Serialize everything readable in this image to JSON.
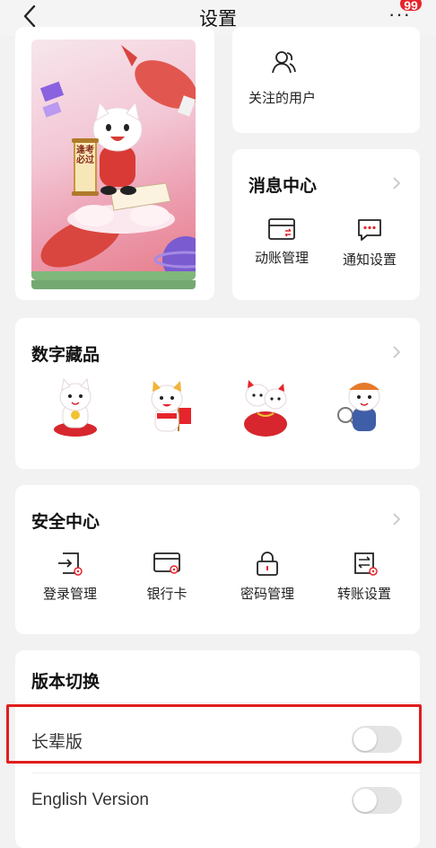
{
  "header": {
    "title": "设置",
    "more_symbol": "···",
    "badge_count": "99"
  },
  "follow": {
    "label": "关注的用户"
  },
  "messages": {
    "title": "消息中心",
    "items": [
      {
        "label": "动账管理",
        "icon": "bill-card-icon"
      },
      {
        "label": "通知设置",
        "icon": "chat-bubble-icon"
      }
    ]
  },
  "poster": {
    "scroll_text": "逢考必过"
  },
  "nft": {
    "title": "数字藏品",
    "items": [
      {
        "icon": "cat-figure-red-cushion"
      },
      {
        "icon": "cat-figure-with-flag"
      },
      {
        "icon": "cat-figure-lucky-bag"
      },
      {
        "icon": "cat-figure-with-racket"
      }
    ]
  },
  "security": {
    "title": "安全中心",
    "items": [
      {
        "label": "登录管理",
        "icon": "login-manage-icon"
      },
      {
        "label": "银行卡",
        "icon": "bank-card-icon"
      },
      {
        "label": "密码管理",
        "icon": "lock-icon"
      },
      {
        "label": "转账设置",
        "icon": "transfer-settings-icon"
      }
    ]
  },
  "version": {
    "title": "版本切换",
    "rows": [
      {
        "label": "长辈版",
        "enabled": false
      },
      {
        "label": "English Version",
        "enabled": false
      }
    ]
  },
  "colors": {
    "accent_red": "#e6242b",
    "highlight_border": "#e11d1d",
    "background": "#f2f2f2",
    "toggle_off": "#e4e4e4"
  }
}
